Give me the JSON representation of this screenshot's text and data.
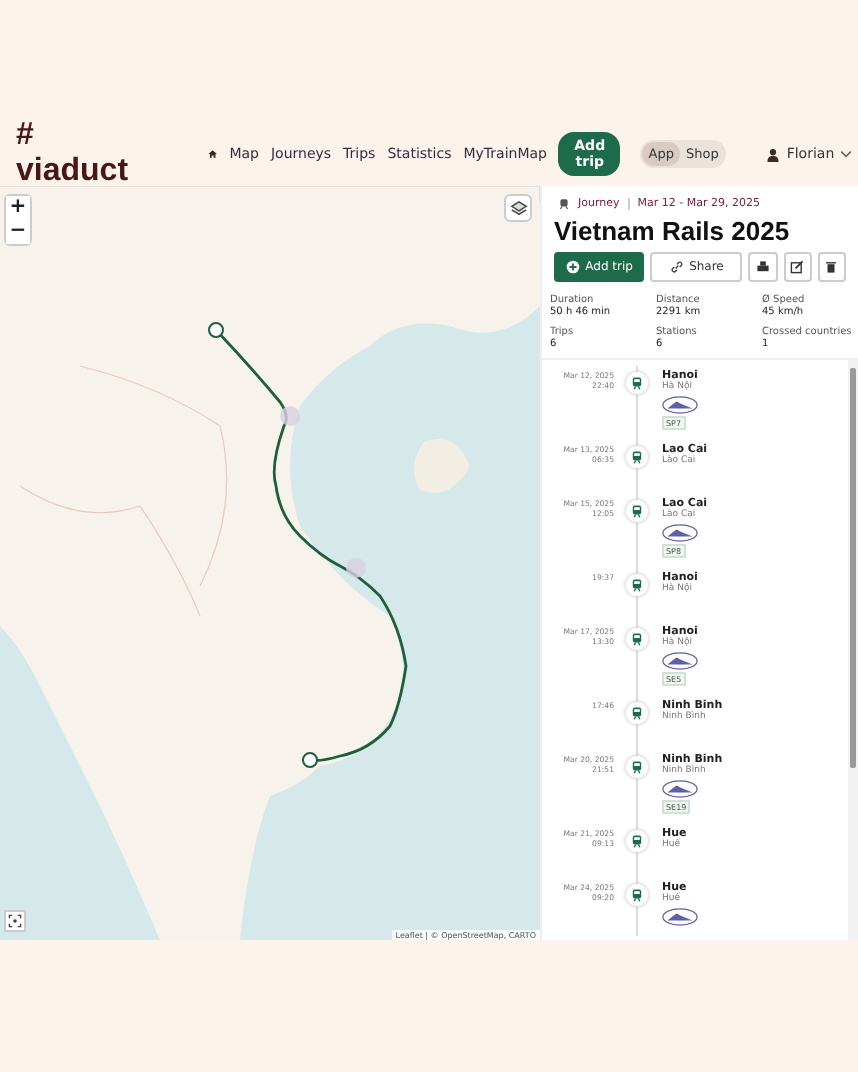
{
  "brand": "# viaduct",
  "nav": [
    {
      "label": "Map"
    },
    {
      "label": "Journeys"
    },
    {
      "label": "Trips"
    },
    {
      "label": "Statistics"
    },
    {
      "label": "MyTrainMap"
    }
  ],
  "add_trip_nav": "Add trip",
  "app_switch": [
    {
      "label": "App",
      "selected": true
    },
    {
      "label": "Shop",
      "selected": false
    }
  ],
  "user": "Florian",
  "map": {
    "zoom_in": "+",
    "zoom_out": "−",
    "attribution": "Leaflet | © OpenStreetMap, CARTO"
  },
  "journey": {
    "label": "Journey",
    "dates": "Mar 12 - Mar 29, 2025",
    "title": "Vietnam Rails 2025",
    "add_trip": "Add trip",
    "share": "Share"
  },
  "stats": [
    {
      "label": "Duration",
      "value": "50 h 46 min"
    },
    {
      "label": "Distance",
      "value": "2291 km"
    },
    {
      "label": "Ø Speed",
      "value": "45 km/h"
    },
    {
      "label": "Trips",
      "value": "6"
    },
    {
      "label": "Stations",
      "value": "6"
    },
    {
      "label": "Crossed countries",
      "value": "1"
    }
  ],
  "stops": [
    {
      "date": "Mar 12, 2025",
      "time": "22:40",
      "name": "Hanoi",
      "local": "Hà Nội",
      "logo": true,
      "train": "SP7"
    },
    {
      "date": "Mar 13, 2025",
      "time": "06:35",
      "name": "Lao Cai",
      "local": "Lào Cai",
      "logo": false
    },
    {
      "date": "Mar 15, 2025",
      "time": "12:05",
      "name": "Lao Cai",
      "local": "Lào Cai",
      "logo": true,
      "train": "SP8"
    },
    {
      "time": "19:37",
      "name": "Hanoi",
      "local": "Hà Nội",
      "logo": false
    },
    {
      "date": "Mar 17, 2025",
      "time": "13:30",
      "name": "Hanoi",
      "local": "Hà Nội",
      "logo": true,
      "train": "SE5"
    },
    {
      "time": "17:46",
      "name": "Ninh Binh",
      "local": "Ninh Bình",
      "logo": false
    },
    {
      "date": "Mar 20, 2025",
      "time": "21:51",
      "name": "Ninh Binh",
      "local": "Ninh Bình",
      "logo": true,
      "train": "SE19"
    },
    {
      "date": "Mar 21, 2025",
      "time": "09:13",
      "name": "Hue",
      "local": "Huế",
      "logo": false
    },
    {
      "date": "Mar 24, 2025",
      "time": "09:20",
      "name": "Hue",
      "local": "Huế",
      "logo": true
    }
  ]
}
